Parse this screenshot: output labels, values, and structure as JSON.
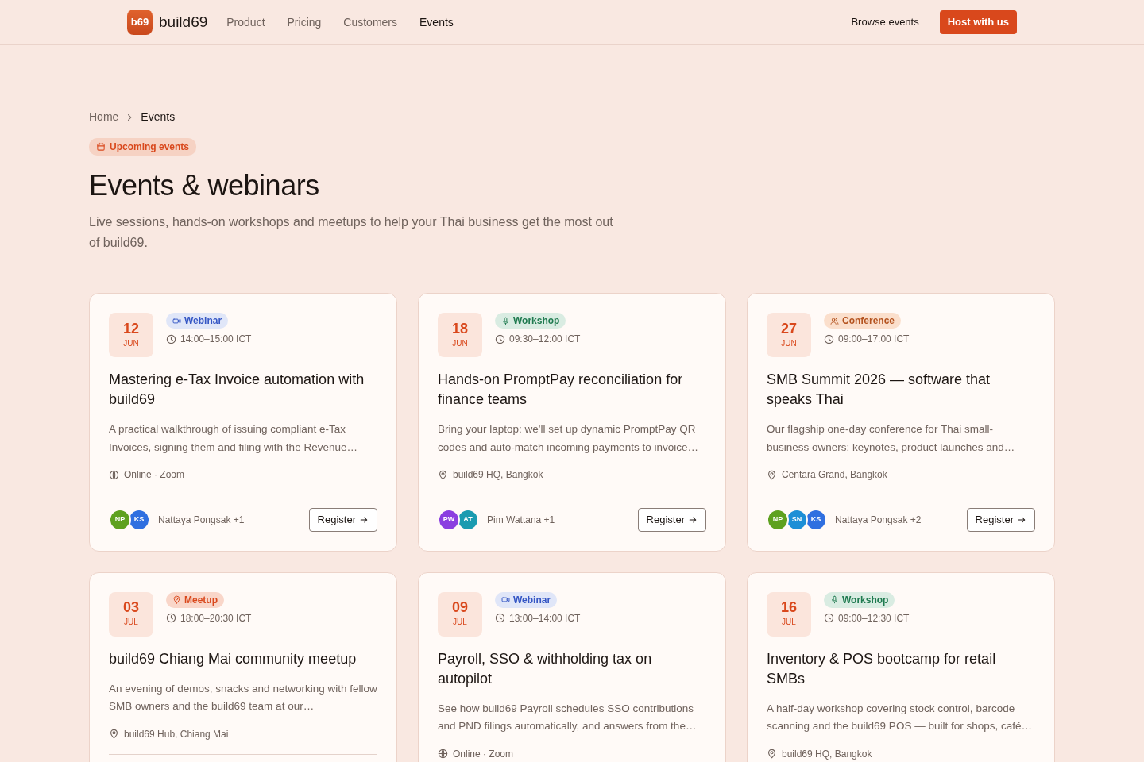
{
  "brand": {
    "logo": "b69",
    "name": "build69"
  },
  "nav": [
    {
      "label": "Product",
      "selected": false
    },
    {
      "label": "Pricing",
      "selected": false
    },
    {
      "label": "Customers",
      "selected": false
    },
    {
      "label": "Events",
      "selected": true
    }
  ],
  "actions": {
    "browse": "Browse events",
    "host": "Host with us"
  },
  "breadcrumb": [
    {
      "label": "Home",
      "selected": false
    },
    {
      "label": "Events",
      "selected": true
    }
  ],
  "eyebrow": "Upcoming events",
  "title": "Events & webinars",
  "intro": "Live sessions, hands-on workshops and meetups to help your Thai business get the most out of build69.",
  "events": [
    {
      "day": "12",
      "month": "JUN",
      "tag": {
        "kind": "webinar",
        "label": "Webinar"
      },
      "time": "14:00–15:00 ICT",
      "title": "Mastering e-Tax Invoice automation with build69",
      "description": "A practical walkthrough of issuing compliant e-Tax Invoices, signing them and filing with the Revenue…",
      "location": {
        "kind": "online",
        "label": "Online · Zoom"
      },
      "hosts": [
        {
          "initials": "NP",
          "color": "#5ea11f"
        },
        {
          "initials": "KS",
          "color": "#2f6fe0"
        }
      ],
      "host_label": "Nattaya Pongsak +1",
      "register": "Register"
    },
    {
      "day": "18",
      "month": "JUN",
      "tag": {
        "kind": "workshop",
        "label": "Workshop"
      },
      "time": "09:30–12:00 ICT",
      "title": "Hands-on PromptPay reconciliation for finance teams",
      "description": "Bring your laptop: we'll set up dynamic PromptPay QR codes and auto-match incoming payments to invoice…",
      "location": {
        "kind": "venue",
        "label": "build69 HQ, Bangkok"
      },
      "hosts": [
        {
          "initials": "PW",
          "color": "#8b3fe0"
        },
        {
          "initials": "AT",
          "color": "#1a9bb0"
        }
      ],
      "host_label": "Pim Wattana +1",
      "register": "Register"
    },
    {
      "day": "27",
      "month": "JUN",
      "tag": {
        "kind": "conference",
        "label": "Conference"
      },
      "time": "09:00–17:00 ICT",
      "title": "SMB Summit 2026 — software that speaks Thai",
      "description": "Our flagship one-day conference for Thai small-business owners: keynotes, product launches and…",
      "location": {
        "kind": "venue",
        "label": "Centara Grand, Bangkok"
      },
      "hosts": [
        {
          "initials": "NP",
          "color": "#5ea11f"
        },
        {
          "initials": "SN",
          "color": "#1d8fd6"
        },
        {
          "initials": "KS",
          "color": "#2f6fe0"
        }
      ],
      "host_label": "Nattaya Pongsak +2",
      "register": "Register"
    },
    {
      "day": "03",
      "month": "JUL",
      "tag": {
        "kind": "meetup",
        "label": "Meetup"
      },
      "time": "18:00–20:30 ICT",
      "title": "build69 Chiang Mai community meetup",
      "description": "An evening of demos, snacks and networking with fellow SMB owners and the build69 team at our…",
      "location": {
        "kind": "venue",
        "label": "build69 Hub, Chiang Mai"
      }
    },
    {
      "day": "09",
      "month": "JUL",
      "tag": {
        "kind": "webinar",
        "label": "Webinar"
      },
      "time": "13:00–14:00 ICT",
      "title": "Payroll, SSO & withholding tax on autopilot",
      "description": "See how build69 Payroll schedules SSO contributions and PND filings automatically, and answers from the…",
      "location": {
        "kind": "online",
        "label": "Online · Zoom"
      }
    },
    {
      "day": "16",
      "month": "JUL",
      "tag": {
        "kind": "workshop",
        "label": "Workshop"
      },
      "time": "09:00–12:30 ICT",
      "title": "Inventory & POS bootcamp for retail SMBs",
      "description": "A half-day workshop covering stock control, barcode scanning and the build69 POS — built for shops, café…",
      "location": {
        "kind": "venue",
        "label": "build69 HQ, Bangkok"
      }
    }
  ]
}
